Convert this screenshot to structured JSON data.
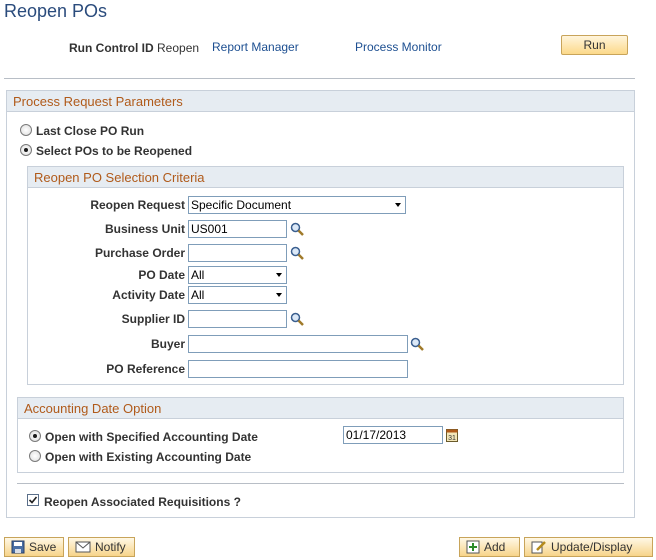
{
  "page": {
    "title": "Reopen POs"
  },
  "run_control": {
    "label": "Run Control ID",
    "value": "Reopen",
    "report_manager": "Report Manager",
    "process_monitor": "Process Monitor",
    "run_button": "Run"
  },
  "process_params": {
    "header": "Process Request Parameters",
    "options": [
      {
        "label": "Last Close PO Run",
        "selected": false
      },
      {
        "label": "Select POs to be Reopened",
        "selected": true
      }
    ]
  },
  "selection_criteria": {
    "header": "Reopen PO Selection Criteria",
    "reopen_request": {
      "label": "Reopen Request",
      "value": "Specific Document"
    },
    "business_unit": {
      "label": "Business Unit",
      "value": "US001"
    },
    "purchase_order": {
      "label": "Purchase Order",
      "value": ""
    },
    "po_date": {
      "label": "PO Date",
      "value": "All"
    },
    "activity_date": {
      "label": "Activity Date",
      "value": "All"
    },
    "supplier_id": {
      "label": "Supplier ID",
      "value": ""
    },
    "buyer": {
      "label": "Buyer",
      "value": ""
    },
    "po_reference": {
      "label": "PO Reference",
      "value": ""
    }
  },
  "accounting": {
    "header": "Accounting Date Option",
    "options": [
      {
        "label": "Open with Specified Accounting Date",
        "selected": true
      },
      {
        "label": "Open with Existing Accounting Date",
        "selected": false
      }
    ],
    "date_value": "01/17/2013"
  },
  "requisitions": {
    "label": "Reopen Associated Requisitions ?",
    "checked": true
  },
  "toolbar": {
    "save": "Save",
    "notify": "Notify",
    "add": "Add",
    "update_display": "Update/Display"
  },
  "colors": {
    "title": "#2a4b7c",
    "link": "#1d4f91",
    "group_header_text": "#b05a1a",
    "group_header_bg": "#e6ecf2",
    "button_bg": "#fcd98a"
  },
  "icons": {
    "lookup": "magnifier-icon",
    "calendar": "calendar-icon",
    "save": "save-icon",
    "notify": "notify-icon",
    "add": "add-icon",
    "update": "update-icon"
  }
}
